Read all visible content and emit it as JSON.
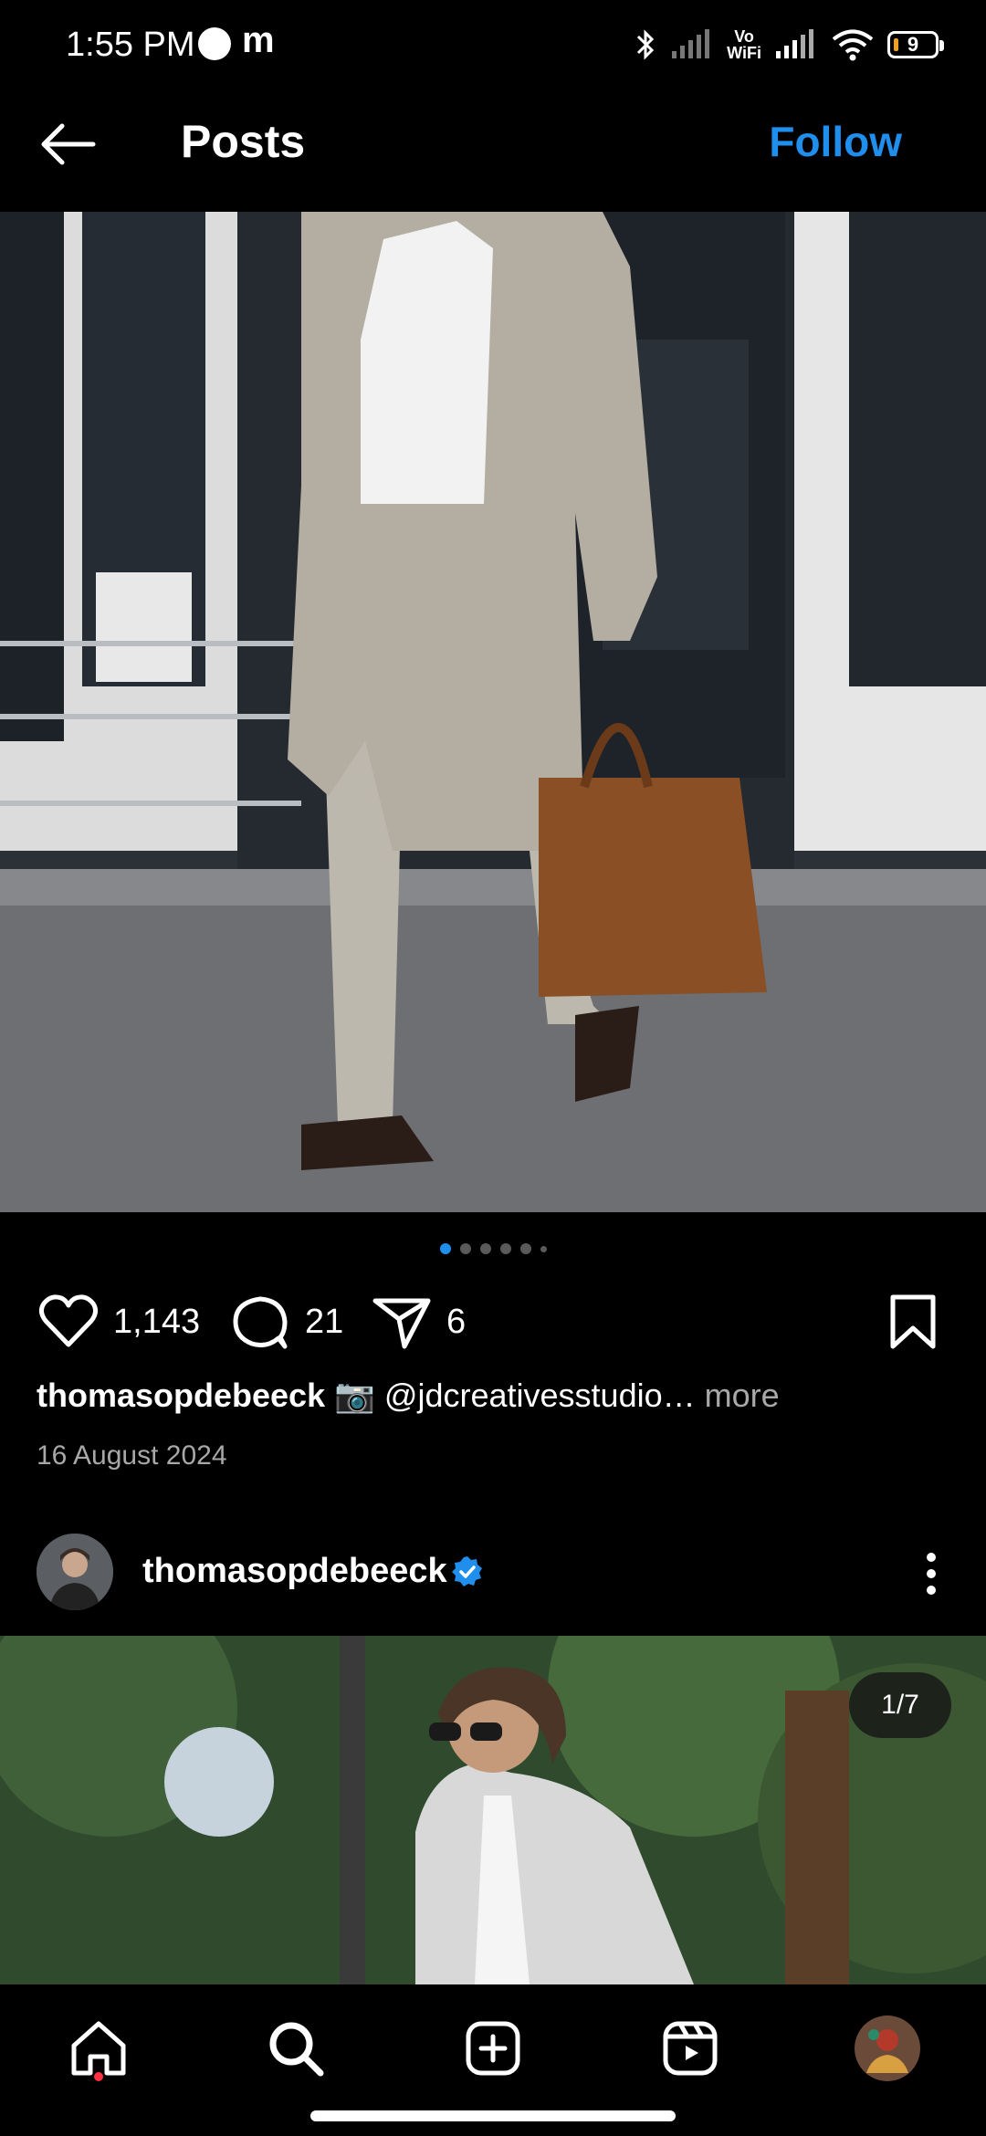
{
  "status_bar": {
    "time": "1:55 PM",
    "carrier_icon": "m",
    "vowifi_line1": "Vo",
    "vowifi_line2": "WiFi",
    "battery": "9"
  },
  "header": {
    "title": "Posts",
    "follow_label": "Follow"
  },
  "post1": {
    "carousel": {
      "count": 6,
      "active_index": 0
    },
    "likes": "1,143",
    "comments": "21",
    "shares": "6",
    "caption_user": "thomasopdebeeck",
    "caption_text": "📷 @jdcreativesstudio…",
    "caption_more": "more",
    "date": "16 August 2024"
  },
  "post2": {
    "username": "thomasopdebeeck",
    "counter": "1/7"
  },
  "colors": {
    "accent": "#1f8eed",
    "notification": "#ff3040",
    "muted_text": "#a8a8a8"
  },
  "icons": [
    "back-arrow-icon",
    "heart-icon",
    "comment-icon",
    "share-icon",
    "bookmark-icon",
    "verified-badge-icon",
    "more-vert-icon",
    "home-icon",
    "search-icon",
    "create-icon",
    "reels-icon"
  ]
}
